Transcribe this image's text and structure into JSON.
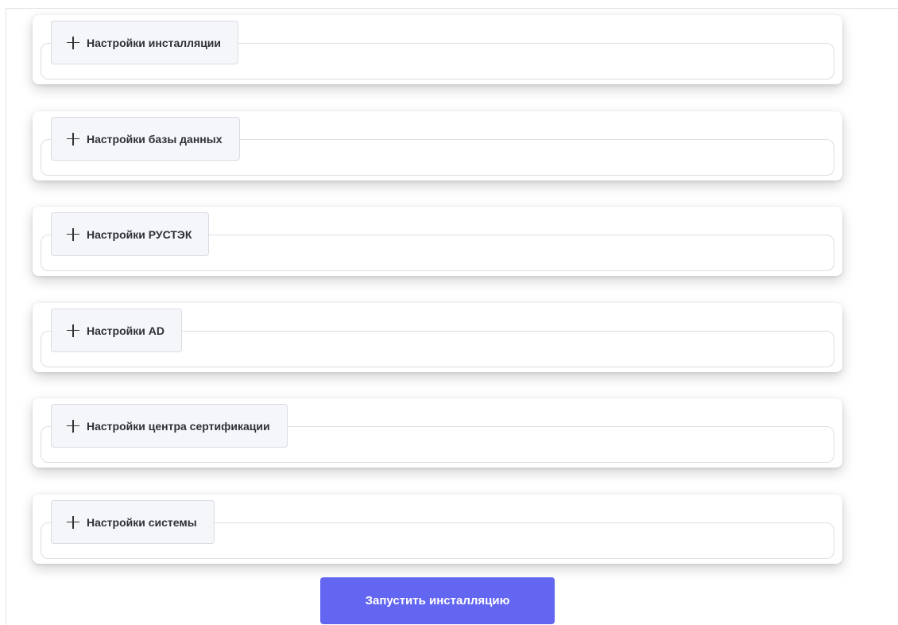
{
  "sections": [
    {
      "label": "Настройки инсталляции"
    },
    {
      "label": "Настройки базы данных"
    },
    {
      "label": "Настройки РУСТЭК"
    },
    {
      "label": "Настройки AD"
    },
    {
      "label": "Настройки центра сертификации"
    },
    {
      "label": "Настройки системы"
    }
  ],
  "section_icon": "plus-icon",
  "install_button": {
    "label": "Запустить инсталляцию",
    "color": "#6366f1"
  }
}
